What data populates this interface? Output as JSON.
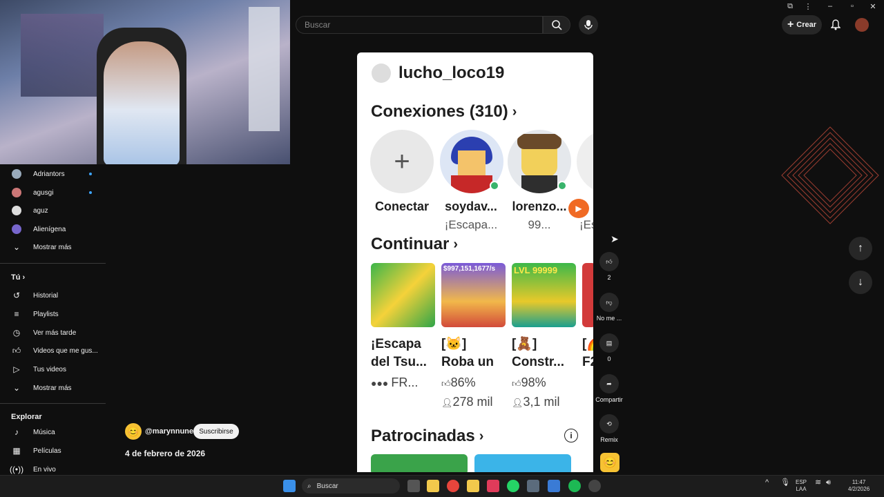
{
  "topbar": {
    "search_placeholder": "Buscar",
    "create_label": "Crear"
  },
  "sidebar": {
    "subscriptions": [
      {
        "label": "Adriantors"
      },
      {
        "label": "agusgi"
      },
      {
        "label": "aguz"
      },
      {
        "label": "Alienígena"
      }
    ],
    "show_more_1": "Mostrar más",
    "you_header": "Tú",
    "you_items": [
      {
        "label": "Historial",
        "icon": "history-icon"
      },
      {
        "label": "Playlists",
        "icon": "playlists-icon"
      },
      {
        "label": "Ver más tarde",
        "icon": "watch-later-icon"
      },
      {
        "label": "Videos que me gus...",
        "icon": "thumbs-up-icon"
      },
      {
        "label": "Tus videos",
        "icon": "your-videos-icon"
      }
    ],
    "show_more_2": "Mostrar más",
    "explore_header": "Explorar",
    "explore_items": [
      {
        "label": "Música",
        "icon": "music-icon"
      },
      {
        "label": "Películas",
        "icon": "movies-icon"
      },
      {
        "label": "En vivo",
        "icon": "live-icon"
      }
    ]
  },
  "channel": {
    "name": "@marynnune",
    "subscribe_label": "Suscribirse",
    "date": "4 de febrero de 2026"
  },
  "phone": {
    "username": "lucho_loco19",
    "connections_title": "Conexiones (310)",
    "connections": [
      {
        "name": "Conectar",
        "sub": ""
      },
      {
        "name": "soydav...",
        "sub": "¡Escapa..."
      },
      {
        "name": "lorenzo...",
        "sub": "99..."
      },
      {
        "name": "",
        "sub": "¡Es"
      }
    ],
    "continue_title": "Continuar",
    "games": [
      {
        "title1": "¡Escapa",
        "title2": "del Tsu...",
        "stat1": "FR...",
        "stat2": ""
      },
      {
        "title1": "[🐱]",
        "title2": "Roba un",
        "stat1": "86%",
        "stat2": "278 mil"
      },
      {
        "title1": "[🧸]",
        "title2": "Constr...",
        "stat1": "98%",
        "stat2": "3,1 mil"
      },
      {
        "title1": "[🌈",
        "title2": "F2",
        "stat1": "",
        "stat2": ""
      }
    ],
    "thumb2_text": "$997,151,1677/s",
    "thumb3_text": "LVL 99999",
    "sponsored_title": "Patrocinadas"
  },
  "actions": {
    "like_count": "2",
    "dislike_label": "No me ...",
    "comments_count": "0",
    "share_label": "Compartir",
    "remix_label": "Remix"
  },
  "taskbar": {
    "search_label": "Buscar",
    "lang1": "ESP",
    "lang2": "LAA",
    "time": "11:47",
    "date": "4/2/2026"
  }
}
